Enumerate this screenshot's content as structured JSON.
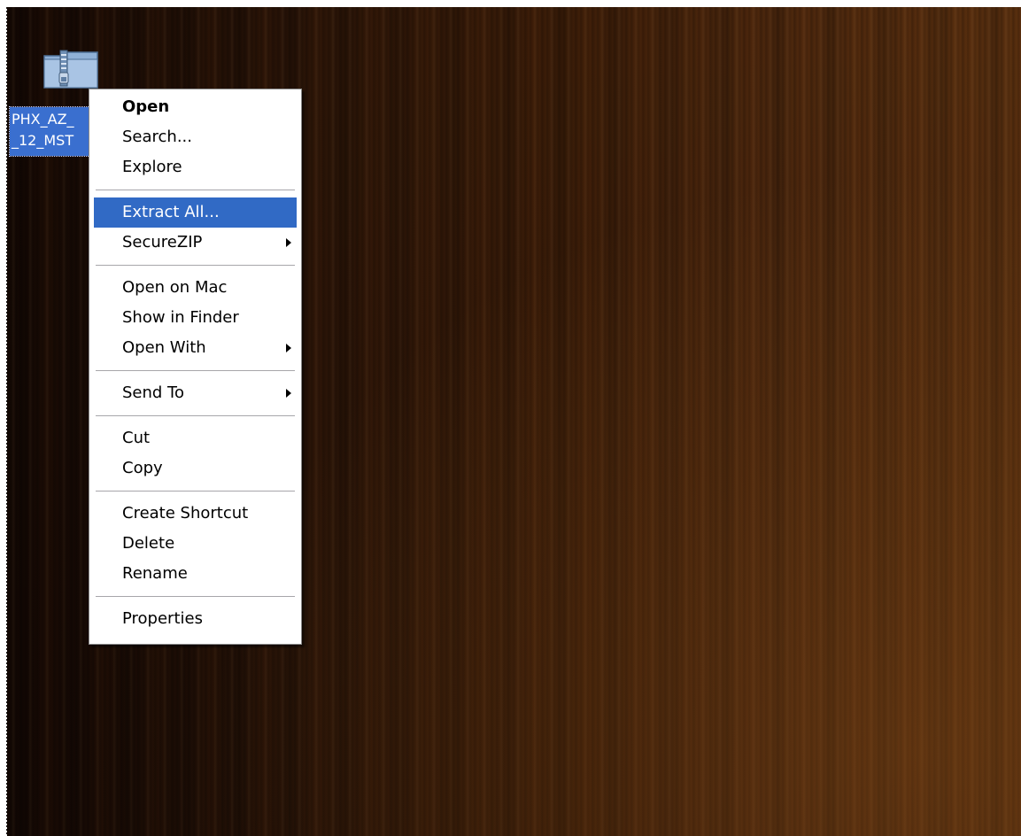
{
  "desktop": {
    "icon": {
      "label": "PHX_AZ_\n_12_MST",
      "icon_name": "zip-folder-icon",
      "selected": true
    }
  },
  "context_menu": {
    "highlight_color": "#316ac5",
    "groups": [
      [
        {
          "label": "Open",
          "bold": true
        },
        {
          "label": "Search..."
        },
        {
          "label": "Explore"
        }
      ],
      [
        {
          "label": "Extract All...",
          "highlighted": true
        },
        {
          "label": "SecureZIP",
          "submenu": true
        }
      ],
      [
        {
          "label": "Open on Mac"
        },
        {
          "label": "Show in Finder"
        },
        {
          "label": "Open With",
          "submenu": true
        }
      ],
      [
        {
          "label": "Send To",
          "submenu": true
        }
      ],
      [
        {
          "label": "Cut"
        },
        {
          "label": "Copy"
        }
      ],
      [
        {
          "label": "Create Shortcut"
        },
        {
          "label": "Delete"
        },
        {
          "label": "Rename"
        }
      ],
      [
        {
          "label": "Properties"
        }
      ]
    ]
  }
}
